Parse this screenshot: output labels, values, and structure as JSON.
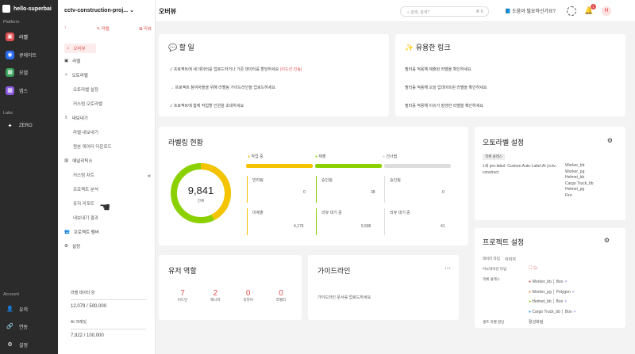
{
  "workspace": "hello-superbai",
  "rail": {
    "section_platform": "Platform",
    "section_labs": "Labs",
    "section_account": "Account",
    "items": [
      "라벨",
      "큐레이트",
      "모델",
      "앱스"
    ],
    "labs": "ZERO",
    "account": [
      "유저",
      "연동",
      "설정"
    ]
  },
  "project": {
    "name": "cctv-construction-proj...",
    "actions": [
      "↑",
      "라벨",
      "리뷰"
    ],
    "menu": [
      "오버뷰",
      "라벨",
      "오토라벨",
      "오토라벨 설정",
      "커스텀 오토라벨",
      "내보내기",
      "라벨 내보내기",
      "원본 데이터 다운로드",
      "애널리틱스",
      "커스텀 차트",
      "프로젝트 분석",
      "유저 리포트",
      "내보내기 결과",
      "프로젝트 멤버",
      "설정"
    ],
    "usage": {
      "label": "라벨 데이터 양",
      "value": "12,079 / 500,000",
      "ai_label": "AI 크레딧",
      "ai_value": "7,922 / 100,000"
    }
  },
  "top": {
    "title": "오버뷰",
    "search": "검색, 검색?",
    "kbd": "⌘ K",
    "help": "도움이 필요하신가요?",
    "avatar": "H",
    "badge": "1"
  },
  "todo": {
    "title": "할 일",
    "items": [
      "프로젝트에 새 데이터를 업로드하거나 기존 데이터를 할당하세요",
      "프로젝트 참여자들을 위해 라벨링 가이드라인을 업로드하세요",
      "프로젝트에 함께 작업할 인원을 초대하세요"
    ],
    "link1": "(이드선 진송)",
    "link2": "라벨링 가이드라인을 업로드"
  },
  "links": {
    "title": "유용한 링크",
    "items": [
      "필터를 적용해 제출된 라벨을 확인하세요",
      "필터를 적용해 오늘 업데이트된 라벨을 확인하세요",
      "필터를 적용해 이슈가 발생한 라벨을 확인하세요"
    ]
  },
  "status": {
    "title": "라벨링 현황",
    "total": "9,841",
    "total_label": "전체",
    "legend": [
      "작업 중",
      "제출",
      "건너뜀"
    ],
    "cells": [
      [
        "반려됨",
        "0"
      ],
      [
        "승인됨",
        "38"
      ],
      [
        "승인됨",
        "0"
      ],
      [
        "미제출",
        "4,176"
      ],
      [
        "리뷰 대기 중",
        "5,586"
      ],
      [
        "리뷰 대기 중",
        "41"
      ]
    ],
    "colors": {
      "work": "#f5c400",
      "submit": "#8bd100",
      "skip": "#ccc"
    }
  },
  "autolabel": {
    "title": "오토라벨 설정",
    "tag": "객체 클래스",
    "name": "1세 pre-label- Custom Auto-Label AI (cctv-construct",
    "classes": [
      "Worker_bb",
      "Worker_pg",
      "Helmet_bb",
      "Cargo Truck_bb",
      "Helmet_pg",
      "Fire"
    ]
  },
  "roles": {
    "title": "유저 역할",
    "items": [
      [
        "7",
        "어드민"
      ],
      [
        "2",
        "매니저"
      ],
      [
        "0",
        "리뷰어"
      ],
      [
        "0",
        "라벨러"
      ]
    ]
  },
  "guide": {
    "title": "가이드라인",
    "text": "가이드라인 문서를 업로드하세요"
  },
  "settings": {
    "title": "프로젝트 설정",
    "rows": [
      [
        "데이터 타입",
        "이미지"
      ],
      [
        "어노테이션 타입",
        ""
      ],
      [
        "객체 클래스",
        ""
      ],
      [
        "셀프 라벨 할당",
        "활성화됨"
      ]
    ],
    "classes": [
      [
        "Worker_bb",
        "Box",
        "#e05050"
      ],
      [
        "Worker_pg",
        "Polygon",
        "#f08040"
      ],
      [
        "Helmet_bb",
        "Box",
        "#8bd100"
      ],
      [
        "Cargo Truck_bb",
        "Box",
        "#2a9df4"
      ]
    ]
  }
}
